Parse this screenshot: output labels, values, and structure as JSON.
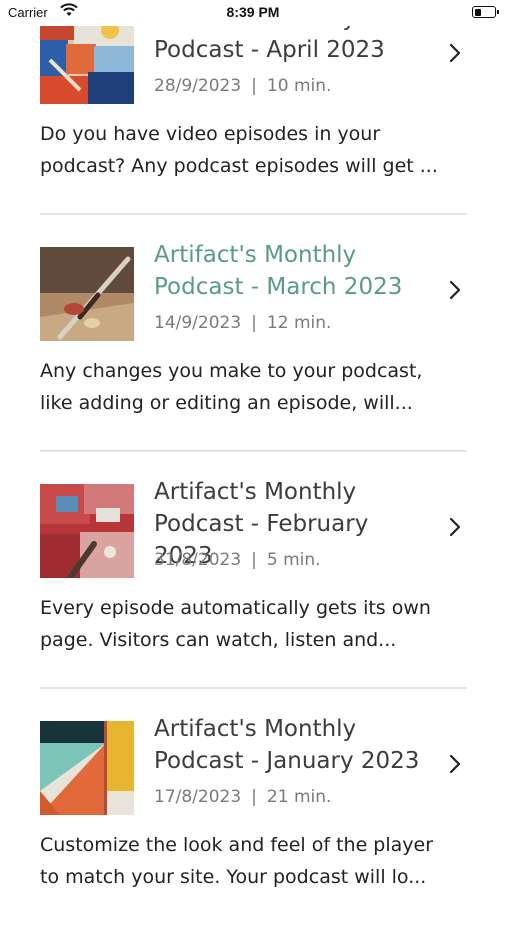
{
  "status_bar": {
    "carrier": "Carrier",
    "time": "8:39 PM",
    "icons": [
      "wifi-icon",
      "battery-icon"
    ],
    "battery_level": 0.35
  },
  "episodes": [
    {
      "title_line1": "Artifact's Monthly",
      "title_line2": "Podcast - April 2023",
      "date": "28/9/2023",
      "separator": "|",
      "duration": "10 min.",
      "desc_line1": "Do you have video episodes in your",
      "desc_line2": "podcast? Any podcast episodes will get ...",
      "active": false
    },
    {
      "title_line1": "Artifact's Monthly",
      "title_line2": "Podcast - March 2023",
      "date": "14/9/2023",
      "separator": "|",
      "duration": "12 min.",
      "desc_line1": "Any changes you make to your podcast,",
      "desc_line2": "like adding or editing an episode, will...",
      "active": true
    },
    {
      "title_line1": "Artifact's Monthly",
      "title_line2": "Podcast - February 2023",
      "date": "31/8/2023",
      "separator": "|",
      "duration": "5 min.",
      "desc_line1": "Every episode automatically gets its own",
      "desc_line2": "page. Visitors can watch, listen and...",
      "active": false
    },
    {
      "title_line1": "Artifact's Monthly",
      "title_line2": "Podcast - January 2023",
      "date": "17/8/2023",
      "separator": "|",
      "duration": "21 min.",
      "desc_line1": "Customize the look and feel of the player",
      "desc_line2": "to match your site. Your podcast will lo...",
      "active": false
    }
  ],
  "colors": {
    "active_title": "#5a9a8c",
    "title": "#3c3c3c",
    "meta": "#7a7a7a",
    "divider": "#e3e3e3"
  },
  "icons": {
    "chevron": "chevron-right-icon"
  }
}
